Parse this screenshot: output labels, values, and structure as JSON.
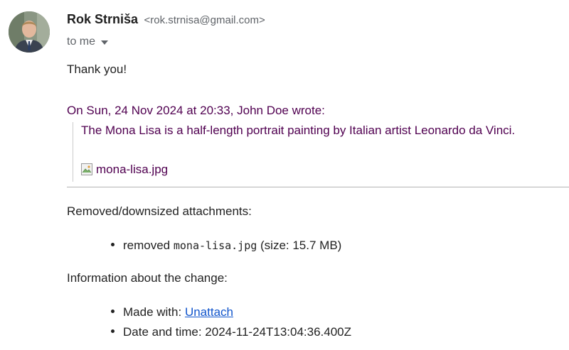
{
  "sender": {
    "name": "Rok Strniša",
    "email": "<rok.strnisa@gmail.com>"
  },
  "recipient": {
    "to_label": "to me"
  },
  "message": {
    "greeting": "Thank you!",
    "quote_attribution": "On Sun, 24 Nov 2024 at 20:33, John Doe wrote:",
    "quote_body": "The Mona Lisa is a half-length portrait painting by Italian artist Leonardo da Vinci.",
    "quote_image_alt": "mona-lisa.jpg"
  },
  "removed_section": {
    "heading": "Removed/downsized attachments:",
    "items": [
      {
        "prefix": "removed ",
        "filename": "mona-lisa.jpg",
        "suffix": " (size: 15.7 MB)"
      }
    ]
  },
  "info_section": {
    "heading": "Information about the change:",
    "made_with_label": "Made with: ",
    "made_with_link": "Unattach",
    "datetime_label": "Date and time: ",
    "datetime_value": "2024-11-24T13:04:36.400Z"
  },
  "colors": {
    "quoted_text": "#500050",
    "link": "#1155cc"
  }
}
